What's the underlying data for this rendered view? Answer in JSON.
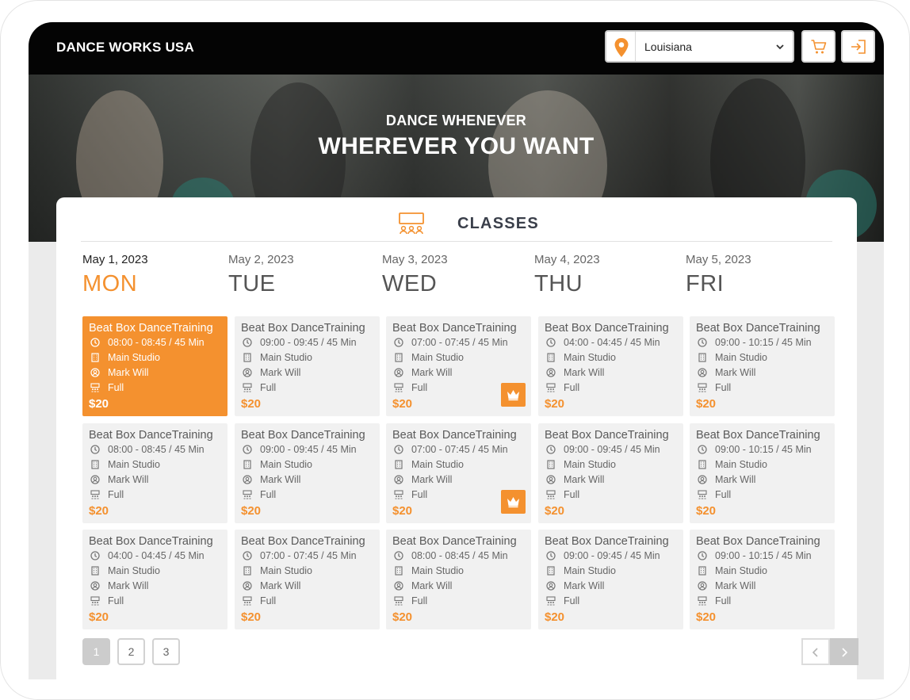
{
  "brand": "DANCE WORKS USA",
  "location": {
    "selected": "Louisiana",
    "icon": "map-pin-icon"
  },
  "header_buttons": [
    {
      "icon": "cart-icon"
    },
    {
      "icon": "login-icon"
    }
  ],
  "hero": {
    "subtitle": "DANCE WHENEVER",
    "title": "WHEREVER YOU WANT"
  },
  "section": {
    "title": "CLASSES",
    "icon": "classroom-icon"
  },
  "colors": {
    "accent": "#f4912f",
    "topbar": "#040404",
    "card_bg": "#f1f1f1"
  },
  "days": [
    {
      "date": "May 1, 2023",
      "name": "MON",
      "active": true
    },
    {
      "date": "May 2, 2023",
      "name": "TUE"
    },
    {
      "date": "May 3, 2023",
      "name": "WED"
    },
    {
      "date": "May 4, 2023",
      "name": "THU"
    },
    {
      "date": "May 5, 2023",
      "name": "FRI"
    }
  ],
  "classes": [
    [
      {
        "title": "Beat Box DanceTraining",
        "time": "08:00 - 08:45 / 45 Min",
        "studio": "Main Studio",
        "instructor": "Mark Will",
        "capacity": "Full",
        "price": "$20",
        "selected": true
      },
      {
        "title": "Beat Box DanceTraining",
        "time": "08:00 - 08:45 / 45 Min",
        "studio": "Main Studio",
        "instructor": "Mark Will",
        "capacity": "Full",
        "price": "$20"
      },
      {
        "title": "Beat Box DanceTraining",
        "time": "04:00 - 04:45 / 45 Min",
        "studio": "Main Studio",
        "instructor": "Mark Will",
        "capacity": "Full",
        "price": "$20"
      }
    ],
    [
      {
        "title": "Beat Box DanceTraining",
        "time": "09:00 - 09:45 / 45 Min",
        "studio": "Main Studio",
        "instructor": "Mark Will",
        "capacity": "Full",
        "price": "$20"
      },
      {
        "title": "Beat Box DanceTraining",
        "time": "09:00 - 09:45 / 45 Min",
        "studio": "Main Studio",
        "instructor": "Mark Will",
        "capacity": "Full",
        "price": "$20"
      },
      {
        "title": "Beat Box DanceTraining",
        "time": "07:00 - 07:45 / 45 Min",
        "studio": "Main Studio",
        "instructor": "Mark Will",
        "capacity": "Full",
        "price": "$20"
      }
    ],
    [
      {
        "title": "Beat Box DanceTraining",
        "time": "07:00 - 07:45 / 45 Min",
        "studio": "Main Studio",
        "instructor": "Mark Will",
        "capacity": "Full",
        "price": "$20",
        "premium": true
      },
      {
        "title": "Beat Box DanceTraining",
        "time": "07:00 - 07:45 / 45 Min",
        "studio": "Main Studio",
        "instructor": "Mark Will",
        "capacity": "Full",
        "price": "$20",
        "premium": true
      },
      {
        "title": "Beat Box DanceTraining",
        "time": "08:00 - 08:45 / 45 Min",
        "studio": "Main Studio",
        "instructor": "Mark Will",
        "capacity": "Full",
        "price": "$20"
      }
    ],
    [
      {
        "title": "Beat Box DanceTraining",
        "time": "04:00 - 04:45 / 45 Min",
        "studio": "Main Studio",
        "instructor": "Mark Will",
        "capacity": "Full",
        "price": "$20"
      },
      {
        "title": "Beat Box DanceTraining",
        "time": "09:00 - 09:45 / 45 Min",
        "studio": "Main Studio",
        "instructor": "Mark Will",
        "capacity": "Full",
        "price": "$20"
      },
      {
        "title": "Beat Box DanceTraining",
        "time": "09:00 - 09:45 / 45 Min",
        "studio": "Main Studio",
        "instructor": "Mark Will",
        "capacity": "Full",
        "price": "$20"
      }
    ],
    [
      {
        "title": "Beat Box DanceTraining",
        "time": "09:00 - 10:15 / 45 Min",
        "studio": "Main Studio",
        "instructor": "Mark Will",
        "capacity": "Full",
        "price": "$20"
      },
      {
        "title": "Beat Box DanceTraining",
        "time": "09:00 - 10:15 / 45 Min",
        "studio": "Main Studio",
        "instructor": "Mark Will",
        "capacity": "Full",
        "price": "$20"
      },
      {
        "title": "Beat Box DanceTraining",
        "time": "09:00 - 10:15 / 45 Min",
        "studio": "Main Studio",
        "instructor": "Mark Will",
        "capacity": "Full",
        "price": "$20"
      }
    ]
  ],
  "pagination": {
    "pages": [
      "1",
      "2",
      "3"
    ],
    "current": "1",
    "prev_icon": "chevron-left-icon",
    "next_icon": "chevron-right-icon"
  }
}
